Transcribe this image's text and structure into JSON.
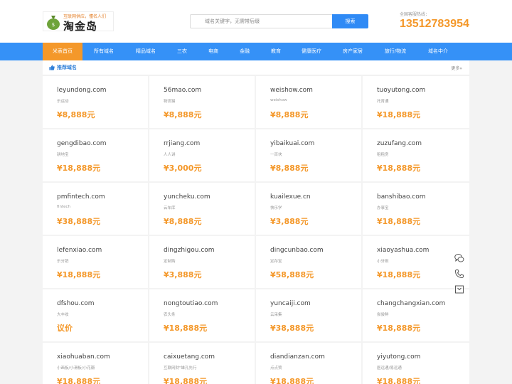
{
  "header": {
    "logo_slogan": "互联网供应，懂名人们",
    "logo_text": "淘金岛",
    "search_placeholder": "域名关键字，无需带后缀",
    "search_button": "搜索",
    "hotline_label": "全国客服热线：",
    "hotline_number": "13512783954"
  },
  "nav": {
    "items": [
      "米表首页",
      "所有域名",
      "精品域名",
      "三农",
      "电商",
      "金融",
      "教育",
      "健康医疗",
      "房产家居",
      "旅行/物流",
      "域名中介"
    ],
    "active_index": 0
  },
  "section": {
    "title": "推荐域名",
    "more": "更多»"
  },
  "domains": [
    {
      "name": "leyundong.com",
      "desc": "乐运动",
      "price": "¥8,888元"
    },
    {
      "name": "56mao.com",
      "desc": "物流猫",
      "price": "¥8,888元"
    },
    {
      "name": "weishow.com",
      "desc": "weishow",
      "price": "¥8,888元"
    },
    {
      "name": "tuoyutong.com",
      "desc": "托育通",
      "price": "¥18,888元"
    },
    {
      "name": "gengdibao.com",
      "desc": "耕地宝",
      "price": "¥18,888元"
    },
    {
      "name": "rrjiang.com",
      "desc": "人人讲",
      "price": "¥3,000元"
    },
    {
      "name": "yibaikuai.com",
      "desc": "一百块",
      "price": "¥8,888元"
    },
    {
      "name": "zuzufang.com",
      "desc": "租租房",
      "price": "¥18,888元"
    },
    {
      "name": "pmfintech.com",
      "desc": "fintech",
      "price": "¥38,888元"
    },
    {
      "name": "yuncheku.com",
      "desc": "云车库",
      "price": "¥8,888元"
    },
    {
      "name": "kuailexue.cn",
      "desc": "快乐学",
      "price": "¥3,888元"
    },
    {
      "name": "banshibao.com",
      "desc": "办事宝",
      "price": "¥18,888元"
    },
    {
      "name": "lefenxiao.com",
      "desc": "乐分销",
      "price": "¥18,888元"
    },
    {
      "name": "dingzhigou.com",
      "desc": "定制购",
      "price": "¥3,888元"
    },
    {
      "name": "dingcunbao.com",
      "desc": "定存宝",
      "price": "¥58,888元"
    },
    {
      "name": "xiaoyashua.com",
      "desc": "小牙刷",
      "price": "¥18,888元"
    },
    {
      "name": "dfshou.com",
      "desc": "大丰收",
      "price": "议价"
    },
    {
      "name": "nongtoutiao.com",
      "desc": "农头条",
      "price": "¥18,888元"
    },
    {
      "name": "yuncaiji.com",
      "desc": "云采集",
      "price": "¥38,888元"
    },
    {
      "name": "changchangxian.com",
      "desc": "尝尝鲜",
      "price": "¥18,888元"
    },
    {
      "name": "xiaohuaban.com",
      "desc": "小画板/小滑板/小花瓣",
      "price": "¥18,888元"
    },
    {
      "name": "caixuetang.com",
      "desc": "互联网财\"雄孔先行",
      "price": "¥18,888元"
    },
    {
      "name": "diandianzan.com",
      "desc": "点点赞",
      "price": "¥18,888元"
    },
    {
      "name": "yiyutong.com",
      "desc": "医远通/易远通",
      "price": "¥18,888元"
    }
  ],
  "float_tools": {
    "icons": [
      "chat-icon",
      "phone-icon",
      "message-icon"
    ]
  },
  "colors": {
    "accent_blue": "#3591f7",
    "accent_orange": "#f4982a"
  }
}
